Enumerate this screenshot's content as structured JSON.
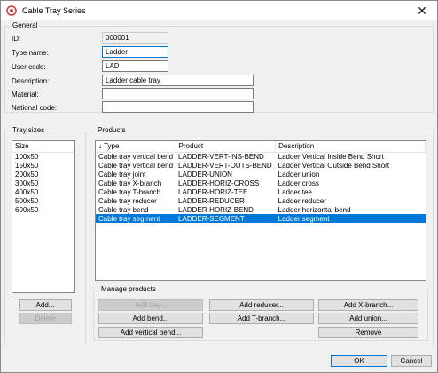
{
  "window": {
    "title": "Cable Tray Series"
  },
  "general": {
    "title": "General",
    "id_label": "ID:",
    "id_value": "000001",
    "type_name_label": "Type name:",
    "type_name_value": "Ladder",
    "user_code_label": "User code:",
    "user_code_value": "LAD",
    "description_label": "Description:",
    "description_value": "Ladder cable tray",
    "material_label": "Material:",
    "material_value": "",
    "national_code_label": "National code:",
    "national_code_value": ""
  },
  "tray_sizes": {
    "title": "Tray sizes",
    "header": "Size",
    "items": [
      "100x50",
      "150x50",
      "200x50",
      "300x50",
      "400x50",
      "500x50",
      "600x50"
    ],
    "add_label": "Add...",
    "delete_label": "Delete"
  },
  "products": {
    "title": "Products",
    "columns": [
      "Type",
      "Product",
      "Description"
    ],
    "sort_arrow": "↓",
    "rows": [
      {
        "type": "Cable tray vertical bend",
        "product": "LADDER-VERT-INS-BEND",
        "description": "Ladder Vertical Inside Bend Short"
      },
      {
        "type": "Cable tray vertical bend",
        "product": "LADDER-VERT-OUTS-BEND",
        "description": "Ladder Vertical Outside Bend Short"
      },
      {
        "type": "Cable tray joint",
        "product": "LADDER-UNION",
        "description": "Ladder union"
      },
      {
        "type": "Cable tray X-branch",
        "product": "LADDER-HORIZ-CROSS",
        "description": "Ladder cross"
      },
      {
        "type": "Cable tray T-branch",
        "product": "LADDER-HORIZ-TEE",
        "description": "Ladder tee"
      },
      {
        "type": "Cable tray reducer",
        "product": "LADDER-REDUCER",
        "description": "Ladder reducer"
      },
      {
        "type": "Cable tray bend",
        "product": "LADDER-HORIZ-BEND",
        "description": "Ladder horizontal bend"
      },
      {
        "type": "Cable tray segment",
        "product": "LADDER-SEGMENT",
        "description": "Ladder segment"
      }
    ],
    "selected_row": 7
  },
  "manage": {
    "title": "Manage products",
    "add_tray": "Add tray...",
    "add_bend": "Add bend...",
    "add_vertical_bend": "Add vertical bend...",
    "add_reducer": "Add reducer...",
    "add_t_branch": "Add T-branch...",
    "add_x_branch": "Add X-branch...",
    "add_union": "Add union...",
    "remove": "Remove"
  },
  "footer": {
    "ok": "OK",
    "cancel": "Cancel"
  },
  "colors": {
    "selection": "#0078d7",
    "window_bg": "#f0f0f0",
    "icon_red": "#d23b3b"
  }
}
